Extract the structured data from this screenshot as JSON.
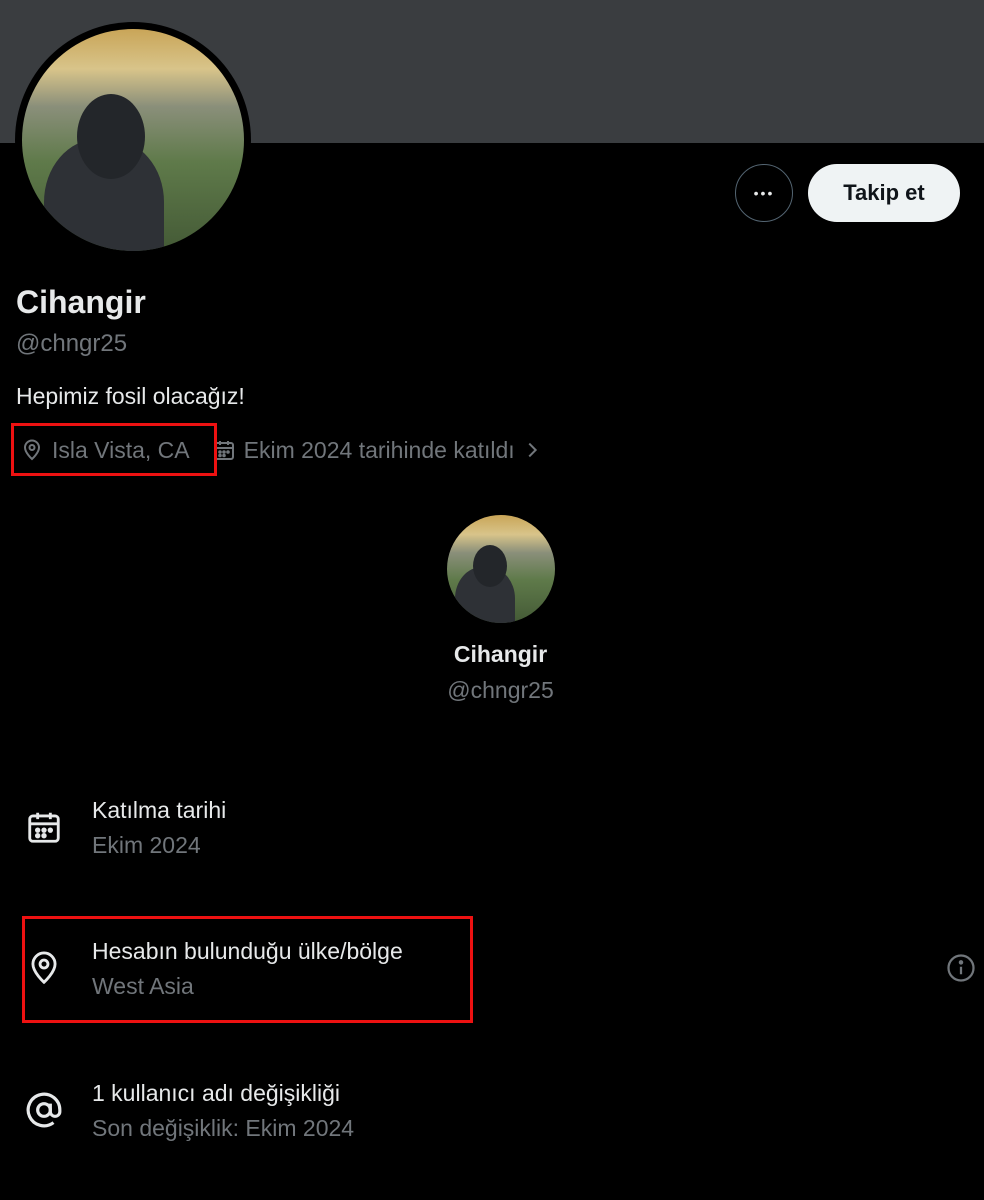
{
  "profile": {
    "display_name": "Cihangir",
    "handle": "@chngr25",
    "bio": "Hepimiz fosil olacağız!",
    "location": "Isla Vista, CA",
    "joined": "Ekim 2024 tarihinde katıldı"
  },
  "actions": {
    "more_label": "•••",
    "follow_label": "Takip et"
  },
  "about": {
    "name": "Cihangir",
    "handle": "@chngr25",
    "rows": [
      {
        "title": "Katılma tarihi",
        "subtitle": "Ekim 2024",
        "icon": "calendar-icon"
      },
      {
        "title": "Hesabın bulunduğu ülke/bölge",
        "subtitle": "West Asia",
        "icon": "location-pin-icon"
      },
      {
        "title": "1 kullanıcı adı değişikliği",
        "subtitle": "Son değişiklik: Ekim 2024",
        "icon": "at-sign-icon"
      }
    ]
  },
  "colors": {
    "background": "#000000",
    "banner": "#3a3d40",
    "text_primary": "#e7e9ea",
    "text_secondary": "#71767b",
    "highlight": "#ee1111"
  }
}
